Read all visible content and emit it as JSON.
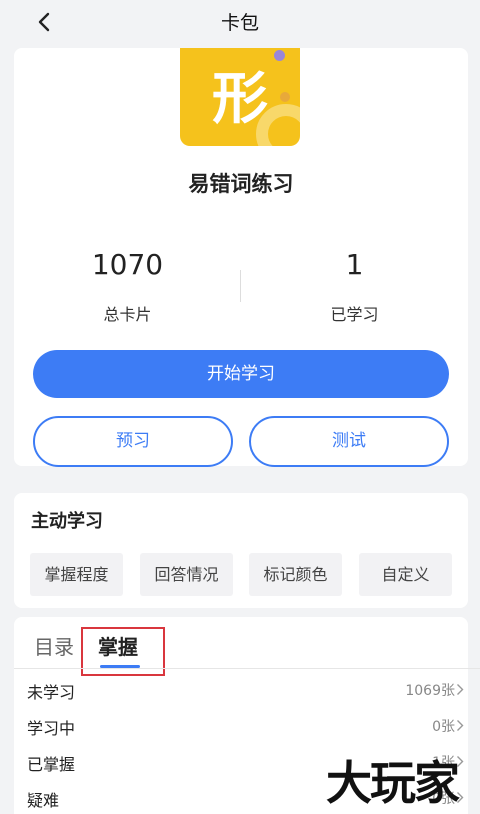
{
  "header": {
    "title": "卡包",
    "back_icon": "chevron-left-icon"
  },
  "deck": {
    "icon_glyph": "形",
    "icon_color": "#f5c21c",
    "name": "易错词练习"
  },
  "stats": {
    "total_value": "1070",
    "total_label": "总卡片",
    "learned_value": "1",
    "learned_label": "已学习"
  },
  "actions": {
    "start": "开始学习",
    "preview": "预习",
    "test": "测试",
    "accent": "#3d7cf5"
  },
  "active_learning": {
    "title": "主动学习",
    "chips": [
      "掌握程度",
      "回答情况",
      "标记颜色",
      "自定义"
    ]
  },
  "tabs": {
    "catalog": "目录",
    "mastery": "掌握"
  },
  "mastery_rows": [
    {
      "label": "未学习",
      "count": "1069张"
    },
    {
      "label": "学习中",
      "count": "0张"
    },
    {
      "label": "已掌握",
      "count": "1张"
    },
    {
      "label": "疑难",
      "count": "0张"
    }
  ],
  "watermark": "大玩家"
}
